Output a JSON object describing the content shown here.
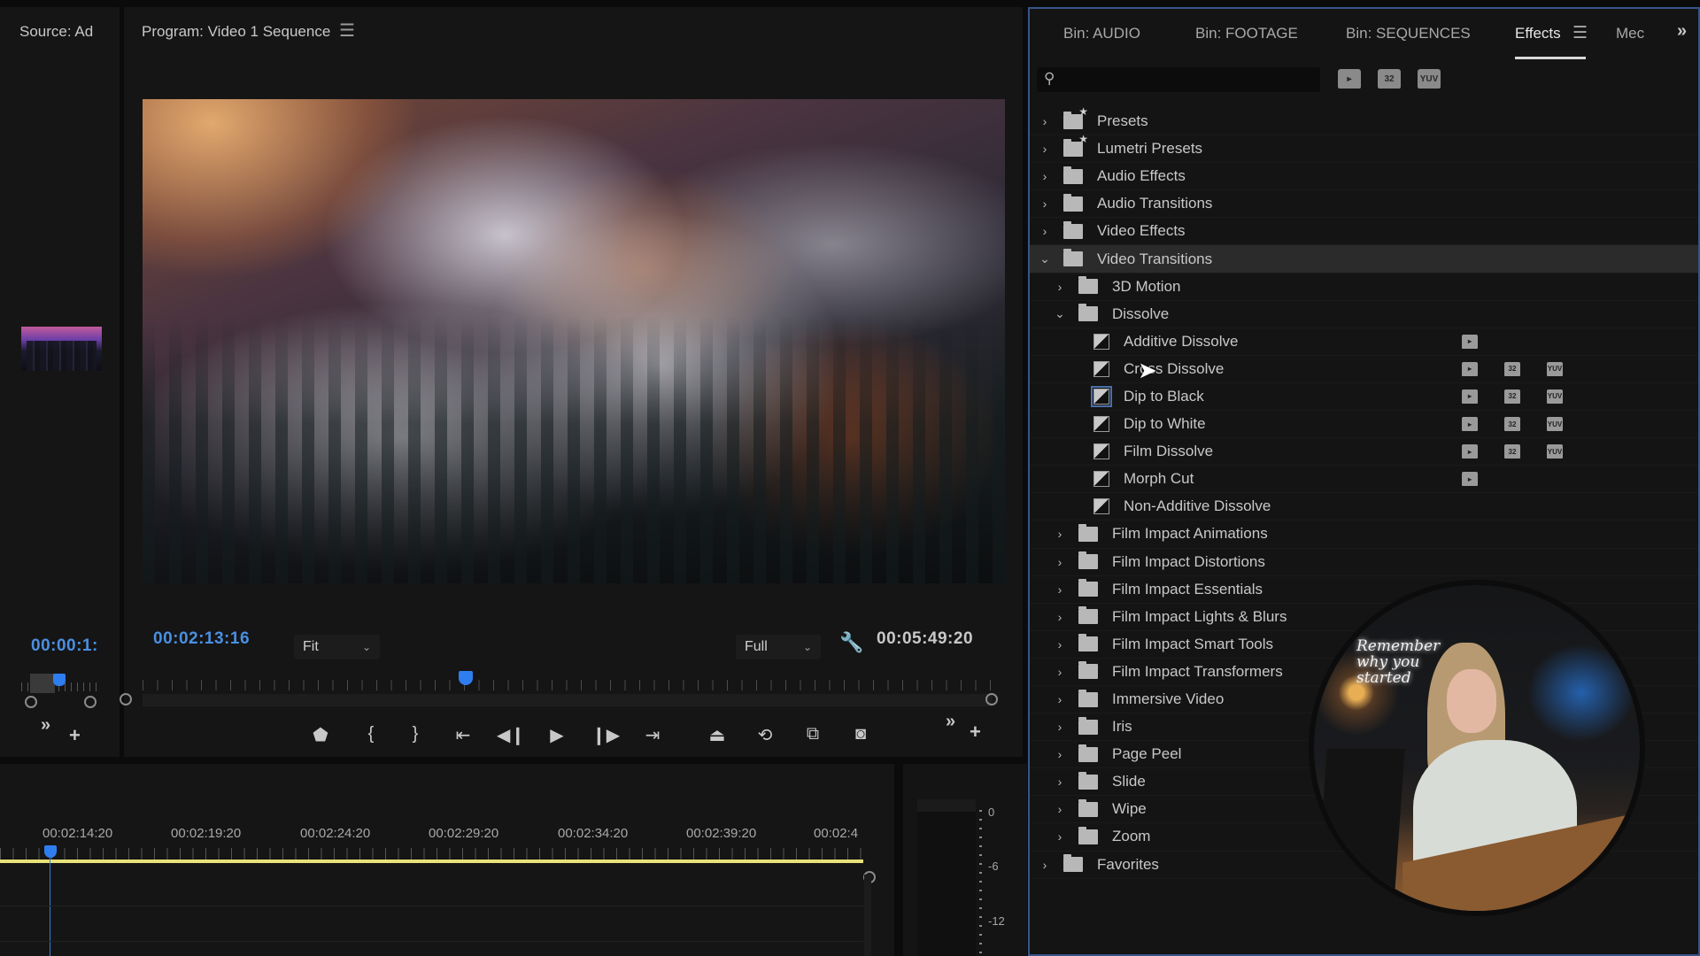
{
  "source_panel": {
    "title": "Source: Ad",
    "timecode": "00:00:1:",
    "overflow_label": "»",
    "add_label": "+"
  },
  "program_panel": {
    "title": "Program: Video 1 Sequence",
    "menu_icon": "hamburger-menu-icon",
    "current_timecode": "00:02:13:16",
    "zoom_dropdown": {
      "selected": "Fit"
    },
    "resolution_dropdown": {
      "selected": "Full"
    },
    "duration_timecode": "00:05:49:20",
    "playhead_position_percent": 38,
    "transport_buttons": [
      {
        "name": "add-marker",
        "glyph": "⬟"
      },
      {
        "name": "mark-in",
        "glyph": "{"
      },
      {
        "name": "mark-out",
        "glyph": "}"
      },
      {
        "name": "go-to-in",
        "glyph": "{←"
      },
      {
        "name": "step-back",
        "glyph": "◀|"
      },
      {
        "name": "play",
        "glyph": "▶"
      },
      {
        "name": "step-forward",
        "glyph": "|▶"
      },
      {
        "name": "go-to-out",
        "glyph": "→}"
      },
      {
        "name": "lift",
        "glyph": "⏏"
      },
      {
        "name": "extract",
        "glyph": "⟲"
      },
      {
        "name": "overwrite",
        "glyph": "⇲"
      },
      {
        "name": "export-frame",
        "glyph": "📷"
      }
    ],
    "overflow_label": "»",
    "add_label": "+"
  },
  "timeline": {
    "ruler_labels": [
      "00:02:14:20",
      "00:02:19:20",
      "00:02:24:20",
      "00:02:29:20",
      "00:02:34:20",
      "00:02:39:20",
      "00:02:4"
    ]
  },
  "audio_meter": {
    "scale_labels": [
      "0",
      "-6",
      "-12"
    ]
  },
  "effects_panel": {
    "tabs": [
      {
        "label": "Bin: AUDIO",
        "active": false
      },
      {
        "label": "Bin: FOOTAGE",
        "active": false
      },
      {
        "label": "Bin: SEQUENCES",
        "active": false
      },
      {
        "label": "Effects",
        "active": true
      },
      {
        "label": "Mec",
        "active": false
      }
    ],
    "overflow_label": "»",
    "search": {
      "value": "",
      "placeholder": ""
    },
    "filter_buttons": [
      {
        "name": "accelerated-effects",
        "label": "▸"
      },
      {
        "name": "32-bit-color",
        "label": "32"
      },
      {
        "name": "yuv-effects",
        "label": "YUV"
      }
    ],
    "tree": [
      {
        "label": "Presets",
        "level": 0,
        "type": "folder-star",
        "expanded": false
      },
      {
        "label": "Lumetri Presets",
        "level": 0,
        "type": "folder-star",
        "expanded": false
      },
      {
        "label": "Audio Effects",
        "level": 0,
        "type": "folder",
        "expanded": false
      },
      {
        "label": "Audio Transitions",
        "level": 0,
        "type": "folder",
        "expanded": false
      },
      {
        "label": "Video Effects",
        "level": 0,
        "type": "folder",
        "expanded": false
      },
      {
        "label": "Video Transitions",
        "level": 0,
        "type": "folder",
        "expanded": true,
        "highlighted": true
      },
      {
        "label": "3D Motion",
        "level": 1,
        "type": "folder",
        "expanded": false
      },
      {
        "label": "Dissolve",
        "level": 1,
        "type": "folder",
        "expanded": true
      },
      {
        "label": "Additive Dissolve",
        "level": 2,
        "type": "effect",
        "badges": [
          "accel"
        ]
      },
      {
        "label": "Cross Dissolve",
        "level": 2,
        "type": "effect",
        "badges": [
          "accel",
          "32",
          "YUV"
        ]
      },
      {
        "label": "Dip to Black",
        "level": 2,
        "type": "effect",
        "badges": [
          "accel",
          "32",
          "YUV"
        ],
        "selected": true
      },
      {
        "label": "Dip to White",
        "level": 2,
        "type": "effect",
        "badges": [
          "accel",
          "32",
          "YUV"
        ]
      },
      {
        "label": "Film Dissolve",
        "level": 2,
        "type": "effect",
        "badges": [
          "accel",
          "32",
          "YUV"
        ]
      },
      {
        "label": "Morph Cut",
        "level": 2,
        "type": "effect",
        "badges": [
          "accel"
        ]
      },
      {
        "label": "Non-Additive Dissolve",
        "level": 2,
        "type": "effect",
        "badges": []
      },
      {
        "label": "Film Impact Animations",
        "level": 1,
        "type": "folder",
        "expanded": false
      },
      {
        "label": "Film Impact Distortions",
        "level": 1,
        "type": "folder",
        "expanded": false
      },
      {
        "label": "Film Impact Essentials",
        "level": 1,
        "type": "folder",
        "expanded": false
      },
      {
        "label": "Film Impact Lights & Blurs",
        "level": 1,
        "type": "folder",
        "expanded": false
      },
      {
        "label": "Film Impact Smart Tools",
        "level": 1,
        "type": "folder",
        "expanded": false
      },
      {
        "label": "Film Impact Transformers",
        "level": 1,
        "type": "folder",
        "expanded": false
      },
      {
        "label": "Immersive Video",
        "level": 1,
        "type": "folder",
        "expanded": false
      },
      {
        "label": "Iris",
        "level": 1,
        "type": "folder",
        "expanded": false
      },
      {
        "label": "Page Peel",
        "level": 1,
        "type": "folder",
        "expanded": false
      },
      {
        "label": "Slide",
        "level": 1,
        "type": "folder",
        "expanded": false
      },
      {
        "label": "Wipe",
        "level": 1,
        "type": "folder",
        "expanded": false
      },
      {
        "label": "Zoom",
        "level": 1,
        "type": "folder",
        "expanded": false
      },
      {
        "label": "Favorites",
        "level": 0,
        "type": "folder",
        "expanded": false
      }
    ]
  },
  "webcam_overlay": {
    "neon_sign_text": "Remember why you started"
  },
  "colors": {
    "accent_blue": "#4a90e2",
    "playhead_blue": "#2f7ef0",
    "panel_focus_border": "#36558a",
    "timeline_work_area": "#e9e27a"
  }
}
